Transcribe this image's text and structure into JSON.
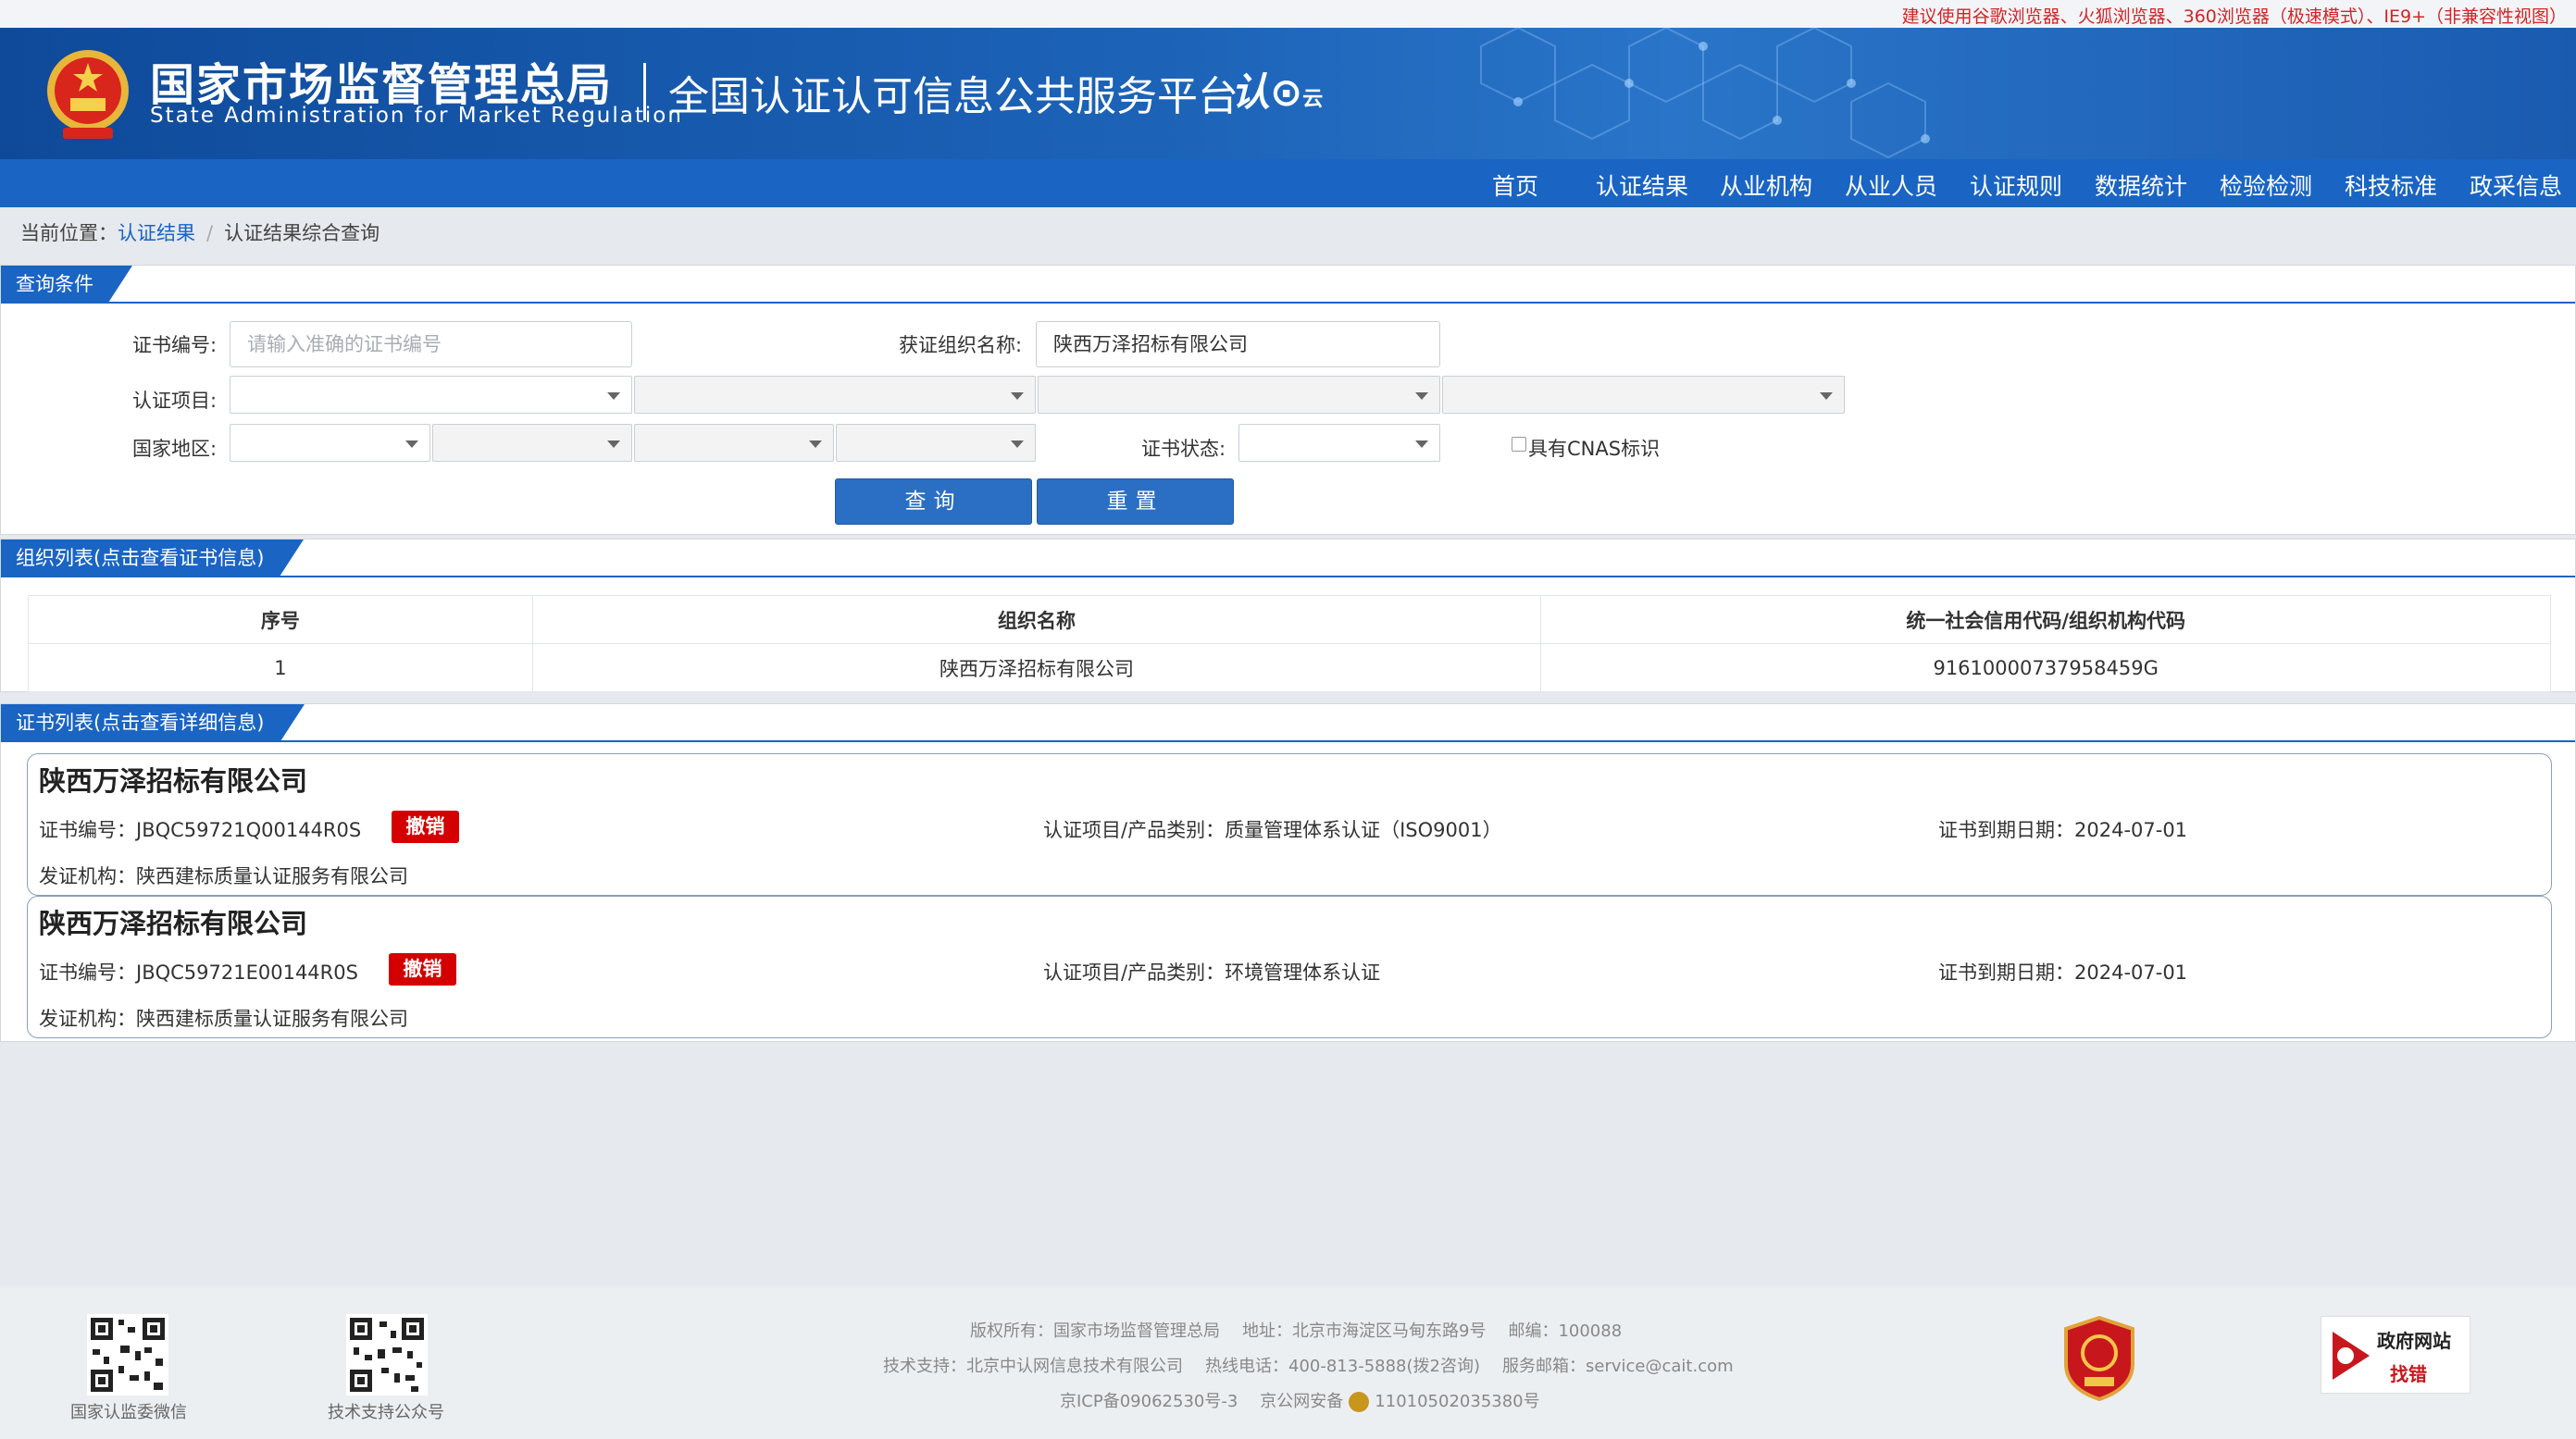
{
  "topbar": {
    "notice": "建议使用谷歌浏览器、火狐浏览器、360浏览器（极速模式）、IE9+（非兼容性视图）"
  },
  "header": {
    "org_name_cn": "国家市场监督管理总局",
    "org_name_en": "State Administration  for  Market Regulation",
    "platform_title": "全国认证认可信息公共服务平台",
    "logo_text": "认",
    "logo_sub": "云"
  },
  "nav": {
    "items": [
      "首页",
      "认证结果",
      "从业机构",
      "从业人员",
      "认证规则",
      "数据统计",
      "检验检测",
      "科技标准",
      "政采信息"
    ]
  },
  "breadcrumb": {
    "prefix": "当前位置：",
    "link": "认证结果",
    "separator": "/",
    "current": "认证结果综合查询"
  },
  "query": {
    "tab_label": "查询条件",
    "cert_no_label": "证书编号:",
    "cert_no_placeholder": "请输入准确的证书编号",
    "org_name_label": "获证组织名称:",
    "org_name_value": "陕西万泽招标有限公司",
    "project_label": "认证项目:",
    "region_label": "国家地区:",
    "status_label": "证书状态:",
    "cnas_label": "具有CNAS标识",
    "search_button": "查询",
    "reset_button": "重置"
  },
  "org_list": {
    "tab_label": "组织列表(点击查看证书信息)",
    "columns": [
      "序号",
      "组织名称",
      "统一社会信用代码/组织机构代码"
    ],
    "rows": [
      [
        "1",
        "陕西万泽招标有限公司",
        "91610000737958459G"
      ]
    ]
  },
  "cert_list": {
    "tab_label": "证书列表(点击查看详细信息)",
    "cert_no_prefix": "证书编号：",
    "project_prefix": "认证项目/产品类别：",
    "expiry_prefix": "证书到期日期：",
    "issuer_prefix": "发证机构：",
    "items": [
      {
        "company": "陕西万泽招标有限公司",
        "cert_no": "JBQC59721Q00144R0S",
        "status": "撤销",
        "project": "质量管理体系认证（ISO9001）",
        "expiry": "2024-07-01",
        "issuer": "陕西建标质量认证服务有限公司"
      },
      {
        "company": "陕西万泽招标有限公司",
        "cert_no": "JBQC59721E00144R0S",
        "status": "撤销",
        "project": "环境管理体系认证",
        "expiry": "2024-07-01",
        "issuer": "陕西建标质量认证服务有限公司"
      }
    ]
  },
  "footer": {
    "qr1_label": "国家认监委微信",
    "qr2_label": "技术支持公众号",
    "copyright": "版权所有：国家市场监督管理总局",
    "address": "地址：北京市海淀区马甸东路9号",
    "postcode": "邮编：100088",
    "tech_support": "技术支持：北京中认网信息技术有限公司",
    "hotline": "热线电话：400-813-5888(拨2咨询)",
    "email": "服务邮箱：service@cait.com",
    "icp": "京ICP备09062530号-3",
    "police": "京公网安备",
    "police_no": "11010502035380号",
    "gov_site_title": "政府网站",
    "gov_site_action": "找错"
  },
  "colors": {
    "primary_blue": "#1a64c4",
    "header_blue": "#0f4a9a",
    "revoked_red": "#d40000",
    "notice_red": "#d32424"
  }
}
